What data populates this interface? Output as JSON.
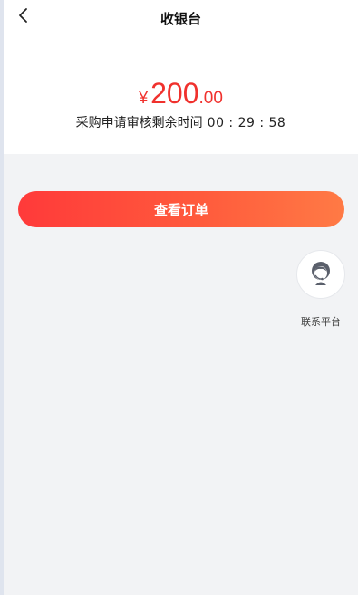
{
  "header": {
    "title": "收银台"
  },
  "payment": {
    "currency_symbol": "¥",
    "amount_integer": "200",
    "amount_decimal": ".00",
    "countdown_label": "采购申请审核剩余时间",
    "countdown_time": "00 : 29 : 58"
  },
  "actions": {
    "view_order_label": "查看订单"
  },
  "support": {
    "label": "联系平台",
    "icon": "customer-service-icon"
  },
  "colors": {
    "accent": "#f0312d",
    "button_start": "#ff3a3a",
    "button_end": "#ff7a45",
    "background": "#f2f3f5"
  }
}
